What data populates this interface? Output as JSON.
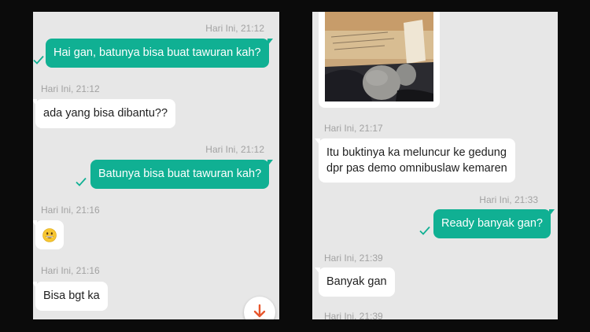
{
  "left_chat": {
    "messages": [
      {
        "time": "Hari Ini, 21:12",
        "text": "Hai gan, batunya bisa buat tawuran kah?",
        "direction": "outgoing",
        "status": "sent"
      },
      {
        "time": "Hari Ini, 21:12",
        "text": "ada yang bisa dibantu??",
        "direction": "incoming"
      },
      {
        "time": "Hari Ini, 21:12",
        "text": "Batunya bisa buat tawuran kah?",
        "direction": "outgoing",
        "status": "sent"
      },
      {
        "time": "Hari Ini, 21:16",
        "emoji": "grinning-face",
        "direction": "incoming"
      },
      {
        "time": "Hari Ini, 21:16",
        "text": "Bisa bgt ka",
        "direction": "incoming"
      }
    ],
    "scroll_button_icon": "arrow-down-icon"
  },
  "right_chat": {
    "messages": [
      {
        "image": "photo of rocks in a package",
        "direction": "incoming"
      },
      {
        "time": "Hari Ini, 21:17",
        "text_line1": "Itu buktinya ka meluncur ke gedung",
        "text_line2": "dpr pas demo omnibuslaw kemaren",
        "direction": "incoming"
      },
      {
        "time": "Hari Ini, 21:33",
        "text": "Ready banyak gan?",
        "direction": "outgoing",
        "status": "sent"
      },
      {
        "time": "Hari Ini, 21:39",
        "text": "Banyak gan",
        "direction": "incoming"
      },
      {
        "time": "Hari Ini, 21:39",
        "direction": "incoming"
      }
    ]
  },
  "colors": {
    "outgoing_bubble": "#10b093",
    "incoming_bubble": "#ffffff",
    "chat_background": "#e7e7e7",
    "timestamp": "#a2a2a2",
    "check": "#10b093",
    "scroll_arrow": "#e8572d"
  }
}
